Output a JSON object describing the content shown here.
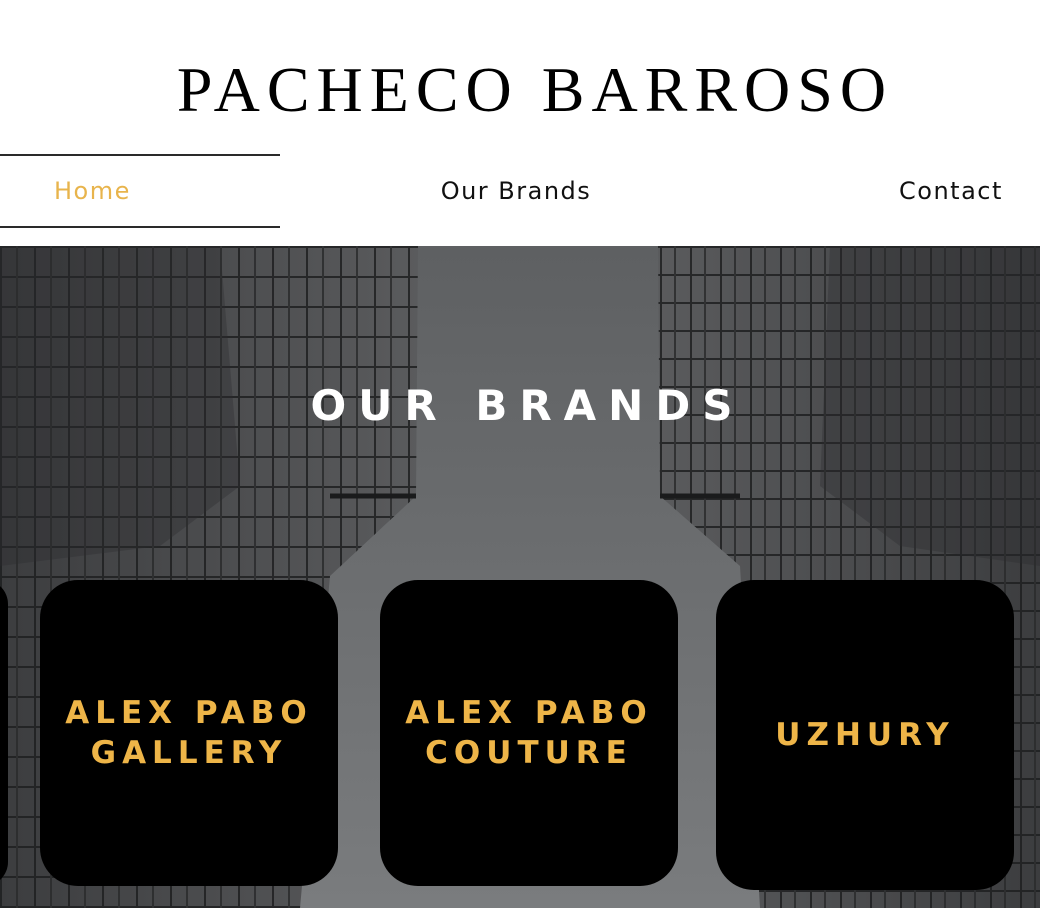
{
  "header": {
    "site_title": "PACHECO BARROSO"
  },
  "nav": {
    "items": [
      {
        "label": "Home",
        "active": true
      },
      {
        "label": "Our Brands",
        "active": false
      },
      {
        "label": "Contact",
        "active": false
      }
    ]
  },
  "hero": {
    "title": "OUR BRANDS",
    "background": "grayscale skyscrapers viewed from below"
  },
  "brands": [
    {
      "label": "ALEX PABO\nGALLERY"
    },
    {
      "label": "ALEX PABO\nCOUTURE"
    },
    {
      "label": "UZHURY"
    }
  ],
  "colors": {
    "accent": "#e8b44c",
    "card_bg": "#000000",
    "card_text": "#eeb548",
    "nav_text": "#111111"
  }
}
